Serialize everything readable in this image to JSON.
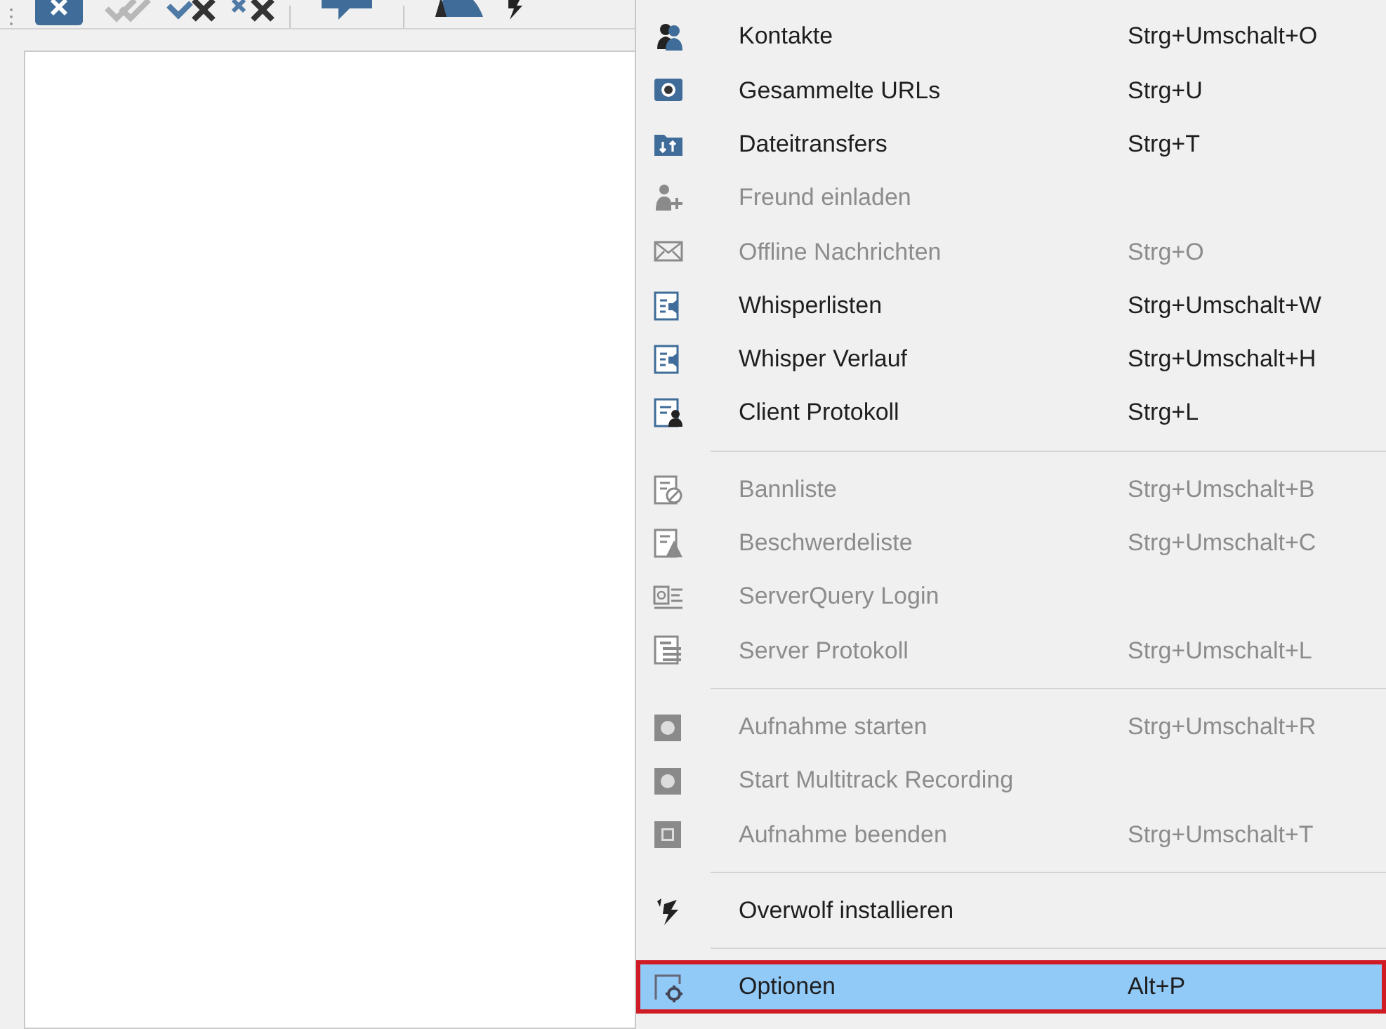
{
  "menu": {
    "items": [
      {
        "kind": "item",
        "label": "Kontakte",
        "shortcut": "Strg+Umschalt+O",
        "disabled": false,
        "selected": false
      },
      {
        "kind": "item",
        "label": "Gesammelte URLs",
        "shortcut": "Strg+U",
        "disabled": false,
        "selected": false
      },
      {
        "kind": "item",
        "label": "Dateitransfers",
        "shortcut": "Strg+T",
        "disabled": false,
        "selected": false
      },
      {
        "kind": "item",
        "label": "Freund einladen",
        "disabled": true,
        "selected": false
      },
      {
        "kind": "item",
        "label": "Offline Nachrichten",
        "shortcut": "Strg+O",
        "disabled": true,
        "selected": false
      },
      {
        "kind": "item",
        "label": "Whisperlisten",
        "shortcut": "Strg+Umschalt+W",
        "disabled": false,
        "selected": false
      },
      {
        "kind": "item",
        "label": "Whisper Verlauf",
        "shortcut": "Strg+Umschalt+H",
        "disabled": false,
        "selected": false
      },
      {
        "kind": "item",
        "label": "Client Protokoll",
        "shortcut": "Strg+L",
        "disabled": false,
        "selected": false
      },
      {
        "kind": "separator"
      },
      {
        "kind": "item",
        "label": "Bannliste",
        "shortcut": "Strg+Umschalt+B",
        "disabled": true,
        "selected": false
      },
      {
        "kind": "item",
        "label": "Beschwerdeliste",
        "shortcut": "Strg+Umschalt+C",
        "disabled": true,
        "selected": false
      },
      {
        "kind": "item",
        "label": "ServerQuery Login",
        "disabled": true,
        "selected": false
      },
      {
        "kind": "item",
        "label": "Server Protokoll",
        "shortcut": "Strg+Umschalt+L",
        "disabled": true,
        "selected": false
      },
      {
        "kind": "separator"
      },
      {
        "kind": "item",
        "label": "Aufnahme starten",
        "shortcut": "Strg+Umschalt+R",
        "disabled": true,
        "selected": false
      },
      {
        "kind": "item",
        "label": "Start Multitrack Recording",
        "disabled": true,
        "selected": false
      },
      {
        "kind": "item",
        "label": "Aufnahme beenden",
        "shortcut": "Strg+Umschalt+T",
        "disabled": true,
        "selected": false
      },
      {
        "kind": "separator"
      },
      {
        "kind": "item",
        "label": "Overwolf installieren",
        "disabled": false,
        "selected": false
      },
      {
        "kind": "separator"
      },
      {
        "kind": "item",
        "label": "Optionen",
        "shortcut": "Alt+P",
        "disabled": false,
        "selected": true
      }
    ]
  }
}
